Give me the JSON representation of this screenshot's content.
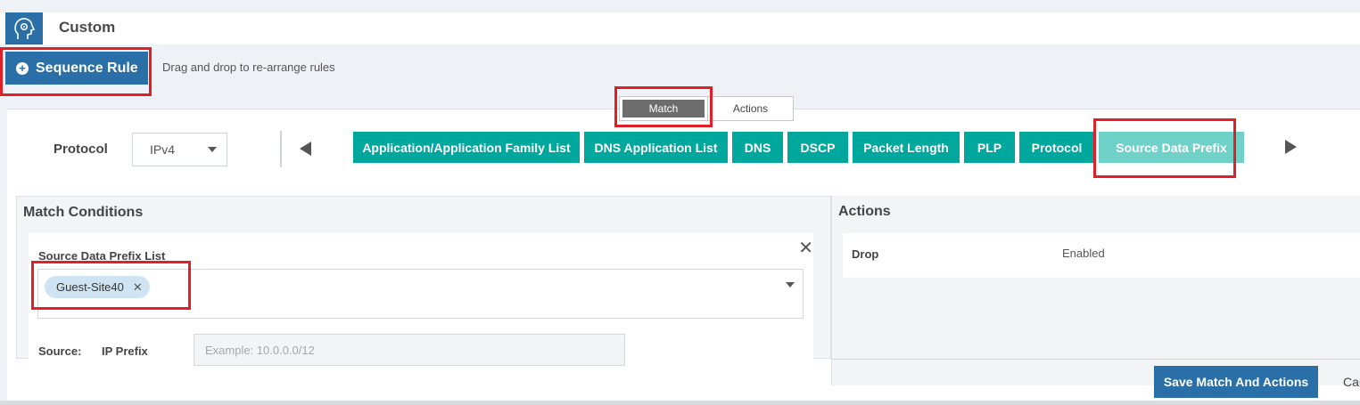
{
  "header": {
    "title": "Custom",
    "icon": "policy-head-icon"
  },
  "toolbar": {
    "sequence_rule_label": "Sequence Rule",
    "hint": "Drag and drop to re-arrange rules"
  },
  "tabs": [
    {
      "label": "Match",
      "active": true
    },
    {
      "label": "Actions",
      "active": false
    }
  ],
  "protocol": {
    "label": "Protocol",
    "value": "IPv4"
  },
  "match_types": [
    {
      "label": "Application/Application Family List",
      "active": false
    },
    {
      "label": "DNS Application List",
      "active": false
    },
    {
      "label": "DNS",
      "active": false
    },
    {
      "label": "DSCP",
      "active": false
    },
    {
      "label": "Packet Length",
      "active": false
    },
    {
      "label": "PLP",
      "active": false
    },
    {
      "label": "Protocol",
      "active": false
    },
    {
      "label": "Source Data Prefix",
      "active": true
    }
  ],
  "match_conditions": {
    "title": "Match Conditions",
    "field_label": "Source Data Prefix List",
    "selected_tags": [
      "Guest-Site40"
    ],
    "source_label": "Source:",
    "ip_prefix_label": "IP Prefix",
    "ip_prefix_placeholder": "Example: 10.0.0.0/12"
  },
  "actions": {
    "title": "Actions",
    "rows": [
      {
        "name": "Drop",
        "value": "Enabled"
      }
    ]
  },
  "footer": {
    "save_label": "Save Match And Actions",
    "cancel_label": "Cancel"
  },
  "colors": {
    "primary": "#2b6fa8",
    "teal": "#00a79d",
    "teal_active": "#6fd1c8",
    "highlight": "#e11f26"
  }
}
